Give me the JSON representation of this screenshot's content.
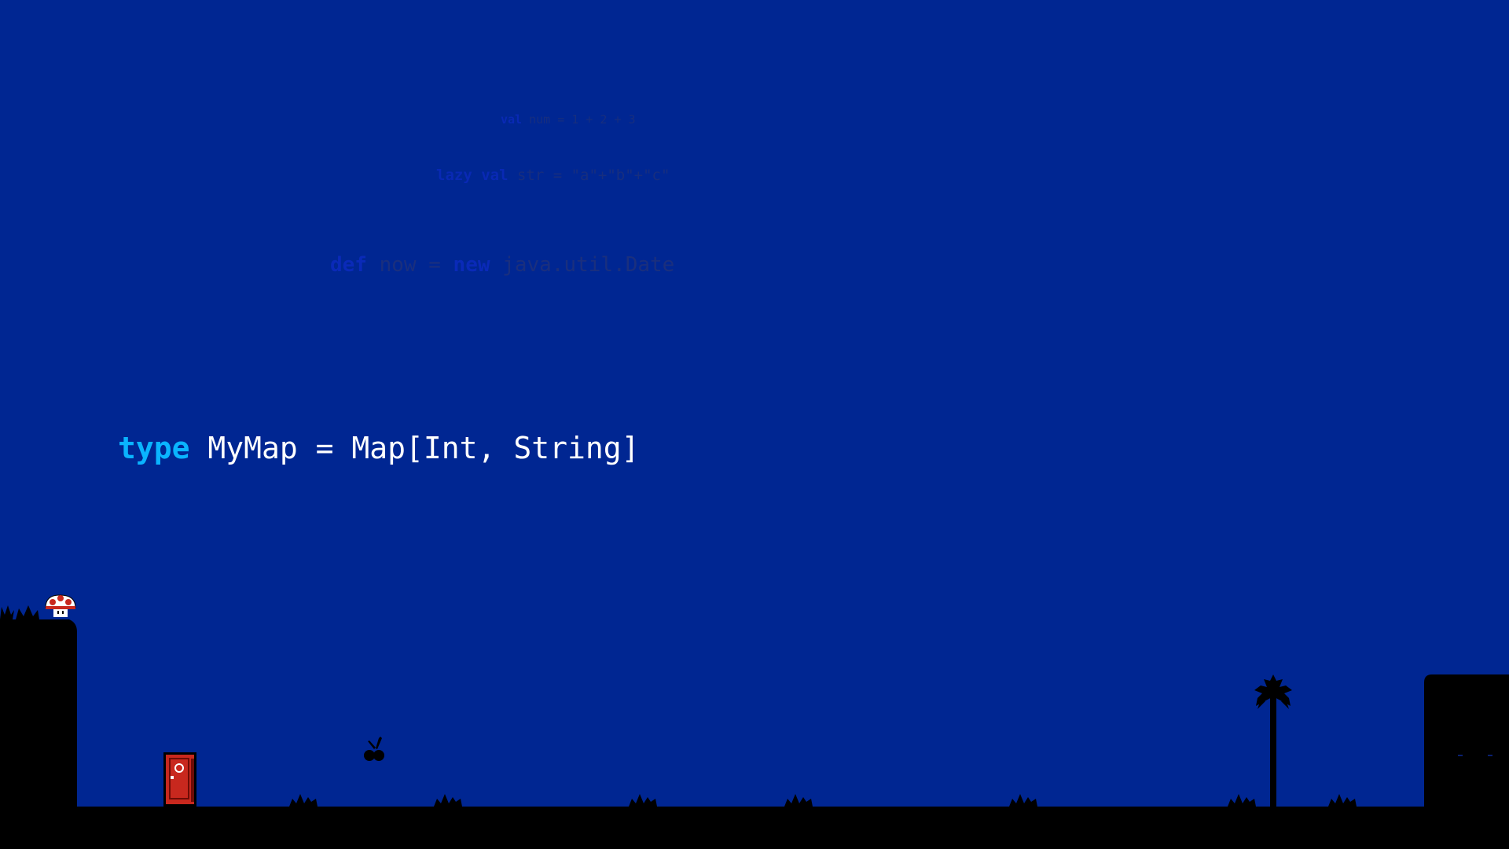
{
  "colors": {
    "background": "#002692",
    "keyword_main": "#0ab4ff",
    "code_text": "#ffffff",
    "faint_keyword": "#0a2ab8",
    "faint_text": "#1a2f7e",
    "silhouette": "#000000"
  },
  "code": {
    "far": {
      "keyword": "val",
      "rest": " num = 1 + 2 + 3"
    },
    "mid": {
      "keyword": "lazy val",
      "rest": " str = \"a\"+\"b\"+\"c\""
    },
    "near": {
      "keyword": "def",
      "keyword2": "new",
      "mid": " now = ",
      "rest": " java.util.Date"
    },
    "main": {
      "keyword": "type",
      "rest": " MyMap = Map[Int, String]"
    }
  },
  "sprites": {
    "mushroom": "mushroom-icon",
    "door": "door-icon",
    "cherry": "cherry-icon",
    "palm_tree": "palm-tree-icon",
    "grass": "grass-tuft-icon"
  }
}
